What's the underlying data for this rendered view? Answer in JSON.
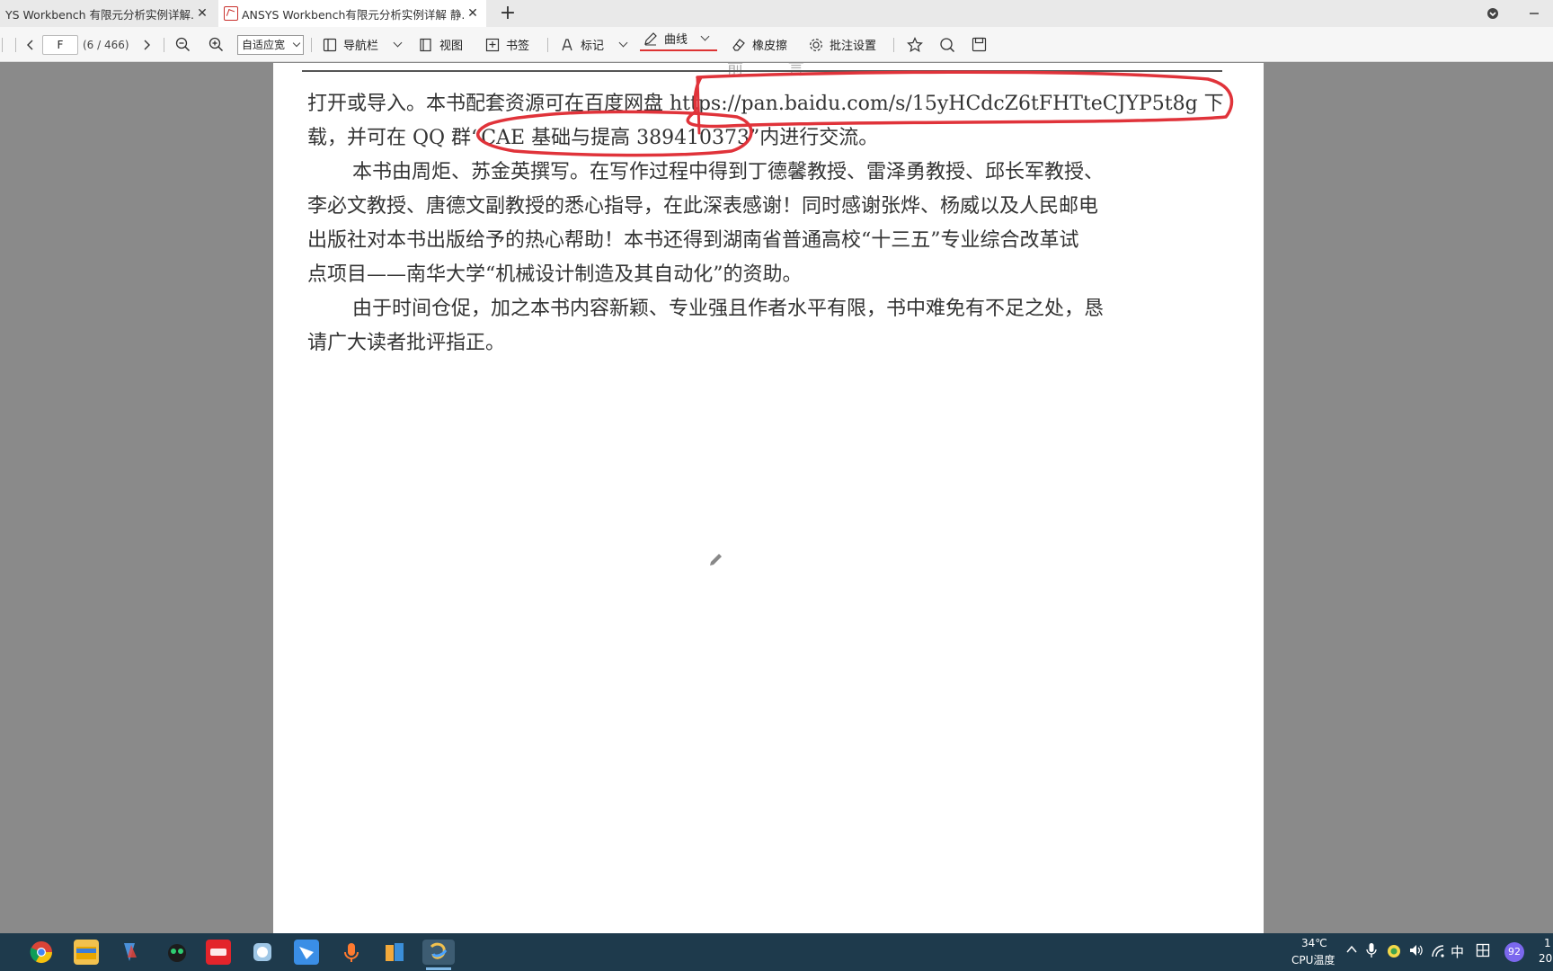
{
  "tabs": [
    {
      "label": "YS  Workbench 有限元分析实例详解...",
      "active": false
    },
    {
      "label": "ANSYS  Workbench有限元分析实例详解  静...",
      "active": true
    }
  ],
  "toolbar": {
    "page_input": "F",
    "page_count": "(6 / 466)",
    "zoom_mode": "自适应宽",
    "nav_label": "导航栏",
    "view_label": "视图",
    "bookmark_label": "书签",
    "mark_label": "标记",
    "curve_label": "曲线",
    "eraser_label": "橡皮擦",
    "annot_settings_label": "批注设置"
  },
  "document": {
    "header_text": "前  言",
    "lines": [
      "打开或导入。本书配套资源可在百度网盘 https://pan.baidu.com/s/15yHCdcZ6tFHTteCJYP5t8g 下",
      "载，并可在 QQ 群“CAE 基础与提高  389410373”内进行交流。",
      "本书由周炬、苏金英撰写。在写作过程中得到丁德馨教授、雷泽勇教授、邱长军教授、",
      "李必文教授、唐德文副教授的悉心指导，在此深表感谢！同时感谢张烨、杨威以及人民邮电",
      "出版社对本书出版给予的热心帮助！本书还得到湖南省普通高校“十三五”专业综合改革试",
      "点项目——南华大学“机械设计制造及其自动化”的资助。",
      "由于时间仓促，加之本书内容新颖、专业强且作者水平有限，书中难免有不足之处，恳",
      "请广大读者批评指正。"
    ],
    "annotation_color": "#e0333a"
  },
  "taskbar": {
    "temp": "34℃",
    "cpu_label": "CPU温度",
    "ime": "中",
    "badge": "92",
    "clock_partial_top": "1",
    "clock_partial_bottom": "20"
  }
}
